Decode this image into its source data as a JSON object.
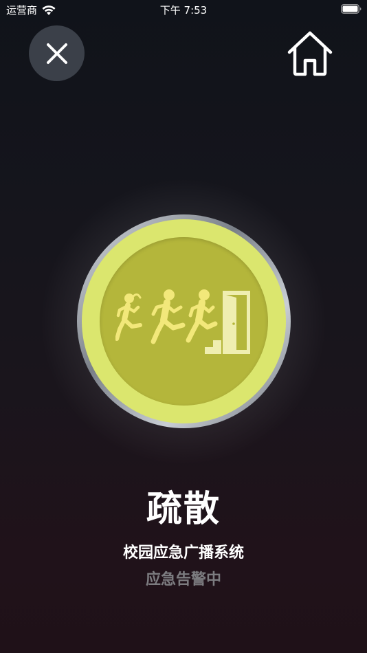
{
  "status_bar": {
    "carrier": "运营商",
    "time": "下午 7:53",
    "wifi_icon": "wifi-icon",
    "battery_icon": "battery-icon"
  },
  "header": {
    "close_icon": "close-icon",
    "home_icon": "home-icon"
  },
  "alarm": {
    "icon": "evacuation-icon",
    "outer_color": "#dbe66e",
    "inner_color": "#b4b63b",
    "title": "疏散"
  },
  "footer": {
    "system_name": "校园应急广播系统",
    "status": "应急告警中"
  }
}
